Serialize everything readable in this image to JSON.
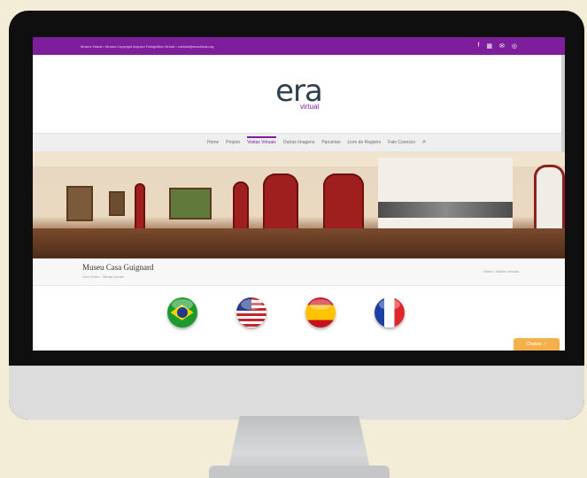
{
  "topbar": {
    "text": "Museu Virtual • Museu Copyright Arquivo Fotográfico Virtual • contato@eravirtual.org",
    "icons": [
      "f",
      "▦",
      "✉",
      "◎"
    ]
  },
  "logo": {
    "main": "era",
    "sub": "virtual"
  },
  "nav": {
    "items": [
      "Home",
      "Projeto",
      "Visitas Virtuais",
      "Outras Imagens",
      "Parcerias",
      "Livro de Registro",
      "Fale Conosco"
    ],
    "active_index": 2,
    "search_icon": "⌕"
  },
  "title": {
    "heading": "Museu Casa Guignard",
    "subtitle": "Ouro Preto · Minas Gerais",
    "breadcrumb": "Home / Visitas Virtuais"
  },
  "flags": [
    "pt-br",
    "en-us",
    "es",
    "fr"
  ],
  "chat": {
    "label": "Chatear ✓"
  },
  "colors": {
    "brand": "#7d1f9c",
    "chat": "#f3b14a"
  }
}
